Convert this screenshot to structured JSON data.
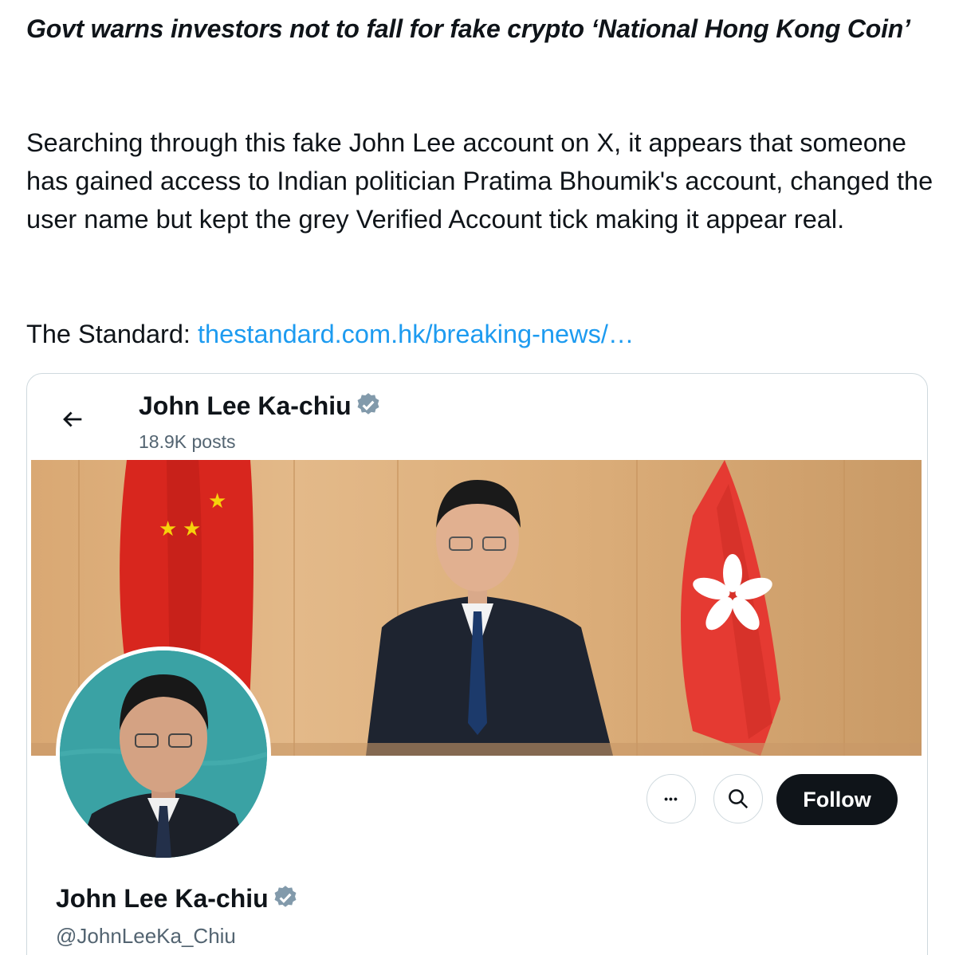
{
  "tweet": {
    "headline": "Govt warns investors not to fall for fake crypto ‘National Hong Kong Coin’",
    "paragraph": "Searching through this fake John Lee account on X, it appears that someone has gained access to Indian politician Pratima Bhoumik's account, changed the user name but kept the grey Verified Account tick making it appear real.",
    "source_prefix": "The Standard: ",
    "source_link": "thestandard.com.hk/breaking-news/…"
  },
  "profile_card": {
    "header_name": "John Lee Ka-chiu",
    "posts_count": "18.9K posts",
    "display_name": "John Lee Ka-chiu",
    "handle": "@JohnLeeKa_Chiu",
    "follow_label": "Follow",
    "more_label": "•••",
    "icons": [
      "back-arrow-icon",
      "verified-badge-icon",
      "more-icon",
      "search-icon"
    ],
    "verified_badge_color": "#829aab",
    "link_color": "#1d9bf0"
  }
}
